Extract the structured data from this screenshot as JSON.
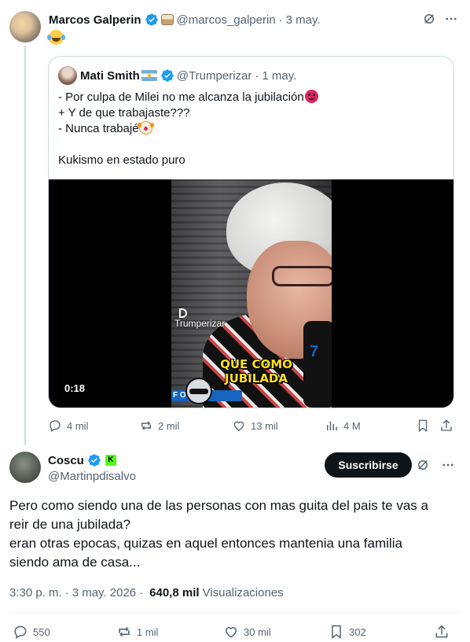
{
  "post": {
    "author_name": "Marcos Galperin",
    "author_handle": "@marcos_galperin",
    "separator": "·",
    "date": "3 may.",
    "quote": {
      "author_name": "Mati Smith",
      "author_handle": "@Trumperizar",
      "separator": "·",
      "date": "1 may.",
      "lines": [
        "- Por culpa de Milei no me alcanza la jubilación",
        "+ Y de que trabajaste???",
        "- Nunca trabajé",
        "Kukismo en estado puro"
      ],
      "video": {
        "watermark": "Trumperizar",
        "caption_line1": "QUE COMO",
        "caption_line2": "JUBILADA",
        "lower_third": "F         O\"",
        "mic_text": "7",
        "duration": "0:18"
      }
    },
    "stats": {
      "replies": "4 mil",
      "reposts": "2 mil",
      "likes": "13 mil",
      "views": "4 M"
    }
  },
  "reply": {
    "author_name": "Coscu",
    "kick_badge": "K",
    "author_handle": "@Martinpdisalvo",
    "subscribe_label": "Suscribirse",
    "lines": [
      "Pero como siendo una de las personas con mas guita del pais te vas a",
      "reir de una jubilada?",
      "eran otras epocas, quizas en aquel entonces mantenia una familia",
      "siendo ama de casa..."
    ],
    "time": "3:30 p. m.",
    "separator": "·",
    "date": "3 may. 2026",
    "separator2": "·",
    "views_count": "640,8 mil",
    "views_label": "Visualizaciones",
    "stats": {
      "replies": "550",
      "reposts": "1 mil",
      "likes": "30 mil",
      "bookmarks": "302"
    }
  },
  "colors": {
    "text": "#0f1419",
    "muted": "#536471",
    "verified": "#1d9bf0",
    "border": "#cfd9de",
    "kick": "#53fc18"
  }
}
